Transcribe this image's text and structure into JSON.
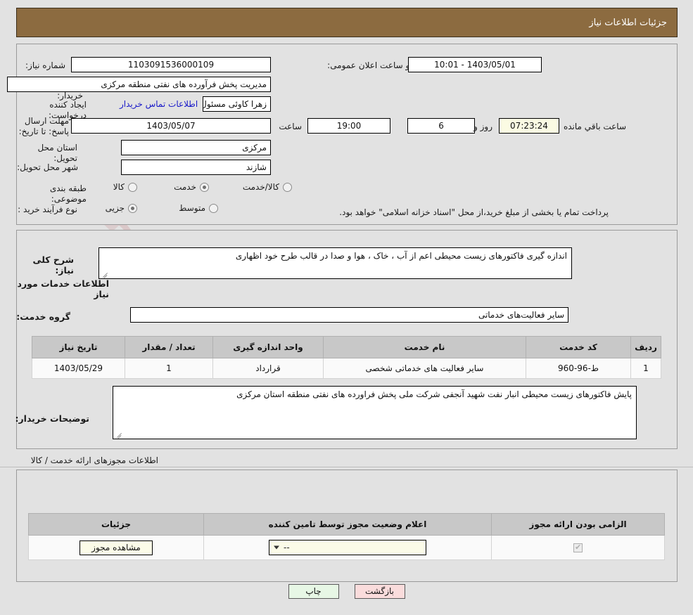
{
  "header": {
    "title": "جزئیات اطلاعات نیاز"
  },
  "form": {
    "need_number_label": "شماره نیاز:",
    "need_number_value": "1103091536000109",
    "announce_label": "تاریخ و ساعت اعلان عمومی:",
    "announce_value": "1403/05/01 - 10:01",
    "buyer_org_label": "نام دستگاه خریدار:",
    "buyer_org_value": "مدیریت پخش فرآورده های نفتی منطقه مرکزی",
    "creator_label": "ایجاد کننده درخواست:",
    "creator_value": "زهرا کاوئی مسئول بهداشت کار صنعتی و حفاظت محیط زیست مدیریت پخش فر",
    "contact_link": "اطلاعات تماس خریدار",
    "deadline_label": "مهلت ارسال پاسخ: تا تاریخ:",
    "deadline_date": "1403/05/07",
    "deadline_time_label": "ساعت",
    "deadline_time": "19:00",
    "days_left": "6",
    "days_unit": "روز و",
    "time_left": "07:23:24",
    "time_left_suffix": "ساعت باقي مانده",
    "province_label": "استان محل تحویل:",
    "province_value": "مرکزی",
    "city_label": "شهر محل تحویل:",
    "city_value": "شازند",
    "category_label": "طبقه بندی موضوعی:",
    "category_options": [
      {
        "label": "کالا",
        "selected": false
      },
      {
        "label": "خدمت",
        "selected": true
      },
      {
        "label": "کالا/خدمت",
        "selected": false
      }
    ],
    "process_label": "نوع فرآیند خرید :",
    "process_options": [
      {
        "label": "جزیی",
        "selected": true
      },
      {
        "label": "متوسط",
        "selected": false
      }
    ],
    "treasury_note": "پرداخت تمام یا بخشی از مبلغ خرید،از محل \"اسناد خزانه اسلامی\" خواهد بود."
  },
  "middle": {
    "description_label": "شرح کلی نیاز:",
    "description_value": "اندازه گیری فاکتورهای زیست محیطی اعم از آب ، خاک ، هوا و صدا در قالب طرح خود اظهاری",
    "services_heading": "اطلاعات خدمات مورد نیاز",
    "service_group_label": "گروه خدمت:",
    "service_group_value": "سایر فعالیت‌های خدماتی",
    "items_table": {
      "headers": [
        "ردیف",
        "کد خدمت",
        "نام خدمت",
        "واحد اندازه گیری",
        "تعداد / مقدار",
        "تاریخ نیاز"
      ],
      "rows": [
        [
          "1",
          "ط-96-960",
          "سایر فعالیت های خدماتی شخصی",
          "قرارداد",
          "1",
          "1403/05/29"
        ]
      ]
    },
    "buyer_notes_label": "توضیحات خریدار:",
    "buyer_notes_value": "پایش فاکتورهای زیست محیطی انبار نفت شهید آنجفی شرکت ملی پخش فراورده های نفتی منطقه استان مرکزی"
  },
  "permits": {
    "section_title": "اطلاعات مجوزهای ارائه خدمت / کالا",
    "table": {
      "headers": [
        "الزامی بودن ارائه مجوز",
        "اعلام وضعیت مجوز توسط تامین کننده",
        "جزئیات"
      ],
      "rows": [
        {
          "required": true,
          "status_value": "--",
          "details_label": "مشاهده مجوز"
        }
      ]
    }
  },
  "footer": {
    "print_label": "چاپ",
    "back_label": "بازگشت"
  },
  "watermark": {
    "text": "AriaTender.net"
  },
  "colors": {
    "header_brown": "#8c6b40",
    "page_bg": "#e2e2e2",
    "link_blue": "#1818c8",
    "print_green": "#e7f7e5",
    "back_pink": "#fadcdc",
    "cream": "#fbfbe8"
  }
}
